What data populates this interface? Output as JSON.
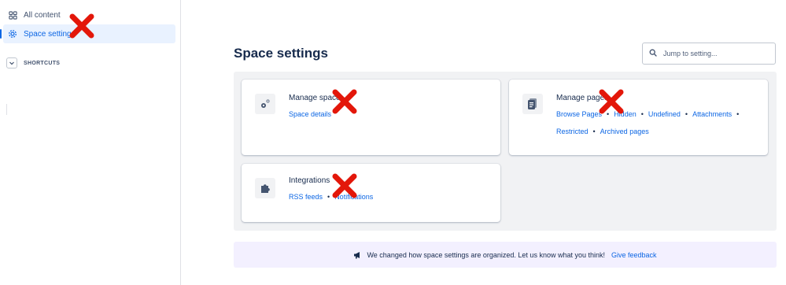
{
  "sidebar": {
    "items": [
      {
        "label": "All content",
        "icon": "grid-icon"
      },
      {
        "label": "Space settings",
        "icon": "gear-icon",
        "active": true
      }
    ],
    "shortcuts_label": "SHORTCUTS"
  },
  "main": {
    "title": "Space settings",
    "search": {
      "placeholder": "Jump to setting..."
    },
    "cards": {
      "manage_space": {
        "title": "Manage space",
        "links": [
          "Space details"
        ]
      },
      "manage_pages": {
        "title": "Manage pages",
        "links": [
          "Browse Pages",
          "Hidden",
          "Undefined",
          "Attachments",
          "Restricted",
          "Archived pages"
        ]
      },
      "integrations": {
        "title": "Integrations",
        "links": [
          "RSS feeds",
          "Notifications"
        ]
      }
    },
    "banner": {
      "message": "We changed how space settings are organized. Let us know what you think!",
      "link": "Give feedback"
    }
  },
  "colors": {
    "accent": "#0c66e4",
    "redaction": "#e3170a"
  }
}
